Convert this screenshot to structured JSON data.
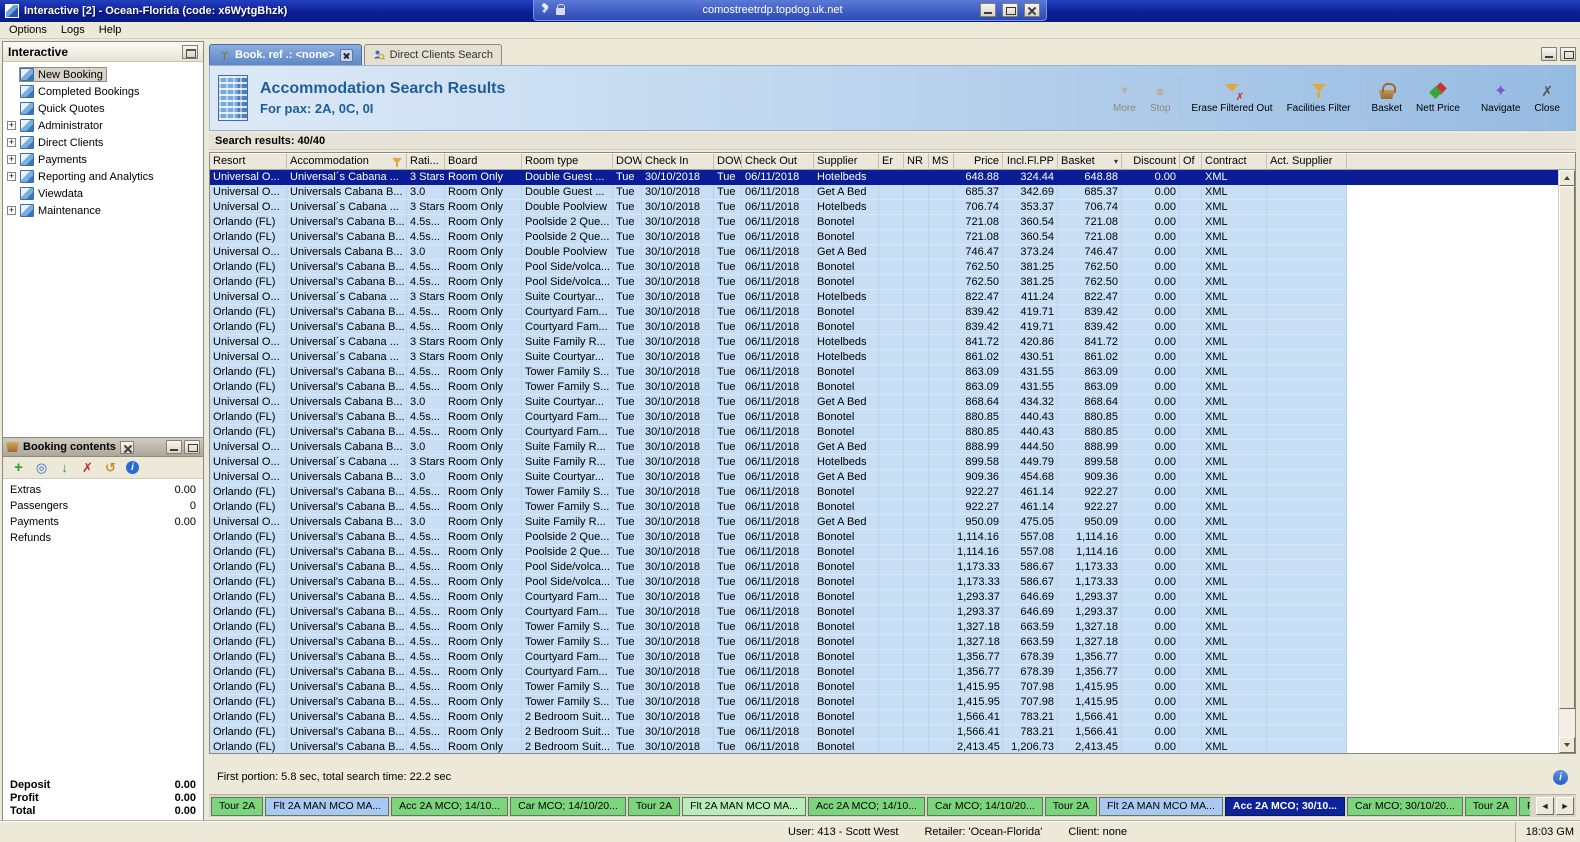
{
  "window": {
    "title": "Interactive [2] - Ocean-Florida (code: x6WytgBhzk)",
    "rdp_address": "comostreetrdp.topdog.uk.net"
  },
  "icons": {
    "singletons": [
      "app-icon",
      "pin-icon",
      "lock-icon",
      "palm-tree-icon",
      "client-search-icon",
      "hotel-building-icon",
      "filter-funnel-icon",
      "sort-icon",
      "info-icon"
    ]
  },
  "menu": {
    "items": [
      "Options",
      "Logs",
      "Help"
    ]
  },
  "sidebar": {
    "title": "Interactive",
    "items": [
      {
        "label": "New Booking",
        "icon": "new-booking-icon",
        "selected": true
      },
      {
        "label": "Completed Bookings",
        "icon": "completed-bookings-icon"
      },
      {
        "label": "Quick Quotes",
        "icon": "quick-quotes-icon"
      },
      {
        "label": "Administrator",
        "icon": "administrator-icon",
        "expandable": true
      },
      {
        "label": "Direct Clients",
        "icon": "direct-clients-icon",
        "expandable": true
      },
      {
        "label": "Payments",
        "icon": "payments-icon",
        "expandable": true
      },
      {
        "label": "Reporting and Analytics",
        "icon": "reporting-icon",
        "expandable": true
      },
      {
        "label": "Viewdata",
        "icon": "viewdata-icon"
      },
      {
        "label": "Maintenance",
        "icon": "maintenance-icon",
        "expandable": true
      }
    ]
  },
  "booking_contents": {
    "title": "Booking contents",
    "toolbar": [
      {
        "name": "add-icon",
        "glyph": "+"
      },
      {
        "name": "view-icon",
        "glyph": "◎"
      },
      {
        "name": "move-to-basket-icon",
        "glyph": "↓"
      },
      {
        "name": "delete-icon",
        "glyph": "✗"
      },
      {
        "name": "refresh-icon",
        "glyph": "↺"
      },
      {
        "name": "info-icon",
        "glyph": "i"
      }
    ],
    "rows": [
      {
        "label": "Extras",
        "value": "0.00"
      },
      {
        "label": "Passengers",
        "value": "0"
      },
      {
        "label": "Payments",
        "value": "0.00"
      },
      {
        "label": "Refunds",
        "value": ""
      }
    ],
    "totals": [
      {
        "label": "Deposit",
        "value": "0.00"
      },
      {
        "label": "Profit",
        "value": "0.00"
      },
      {
        "label": "Total",
        "value": "0.00"
      }
    ]
  },
  "tabs": [
    {
      "label": "Book. ref .: <none>",
      "icon": "palm-tree-icon",
      "active": true,
      "closable": true
    },
    {
      "label": "Direct Clients Search",
      "icon": "client-search-icon",
      "active": false
    }
  ],
  "header": {
    "icon": "hotel-building-icon",
    "title": "Accommodation Search Results",
    "subtitle": "For pax: 2A, 0C, 0I",
    "toolbar": [
      {
        "label": "More",
        "icon": "more-icon",
        "disabled": true
      },
      {
        "label": "Stop",
        "icon": "stop-icon",
        "disabled": true,
        "divider_after": true
      },
      {
        "label": "Erase Filtered Out",
        "icon": "erase-filter-icon"
      },
      {
        "label": "Facilities Filter",
        "icon": "facilities-filter-icon",
        "divider_after": true
      },
      {
        "label": "Basket",
        "icon": "basket-icon"
      },
      {
        "label": "Nett Price",
        "icon": "nett-price-icon",
        "divider_after": true
      },
      {
        "label": "Navigate",
        "icon": "navigate-icon"
      },
      {
        "label": "Close",
        "icon": "close-icon"
      }
    ]
  },
  "results": {
    "summary": "Search results: 40/40",
    "status": "First portion: 5.8 sec, total search time: 22.2 sec",
    "status_icon": "info-icon",
    "columns": [
      {
        "label": "Resort"
      },
      {
        "label": "Accommodation",
        "icon": "filter-funnel-icon"
      },
      {
        "label": "Rati..."
      },
      {
        "label": "Board"
      },
      {
        "label": "Room type"
      },
      {
        "label": "DOW"
      },
      {
        "label": "Check In"
      },
      {
        "label": "DOW"
      },
      {
        "label": "Check Out"
      },
      {
        "label": "Supplier"
      },
      {
        "label": "Er"
      },
      {
        "label": "NR"
      },
      {
        "label": "MS"
      },
      {
        "label": "Price"
      },
      {
        "label": "Incl.Fl.PP"
      },
      {
        "label": "Basket",
        "icon": "sort-icon"
      },
      {
        "label": "Discount"
      },
      {
        "label": "Of"
      },
      {
        "label": "Contract"
      },
      {
        "label": "Act. Supplier"
      }
    ],
    "row_constants": {
      "board": "Room Only",
      "dow_in": "Tue",
      "check_in": "30/10/2018",
      "dow_out": "Tue",
      "check_out": "06/11/2018",
      "discount": "0.00",
      "contract": "XML"
    },
    "rows": [
      {
        "resort": "Universal O...",
        "accommodation": "Universal´s Cabana ...",
        "rating": "3 Stars",
        "room_type": "Double Guest ...",
        "supplier": "Hotelbeds",
        "price": "648.88",
        "incl_fl_pp": "324.44",
        "basket": "648.88",
        "selected": true
      },
      {
        "resort": "Universal O...",
        "accommodation": "Universals Cabana B...",
        "rating": "3.0",
        "room_type": "Double Guest ...",
        "supplier": "Get A Bed",
        "price": "685.37",
        "incl_fl_pp": "342.69",
        "basket": "685.37"
      },
      {
        "resort": "Universal O...",
        "accommodation": "Universal´s Cabana ...",
        "rating": "3 Stars",
        "room_type": "Double Poolview",
        "supplier": "Hotelbeds",
        "price": "706.74",
        "incl_fl_pp": "353.37",
        "basket": "706.74"
      },
      {
        "resort": "Orlando (FL)",
        "accommodation": "Universal's Cabana B...",
        "rating": "4.5s...",
        "room_type": "Poolside 2 Que...",
        "supplier": "Bonotel",
        "price": "721.08",
        "incl_fl_pp": "360.54",
        "basket": "721.08"
      },
      {
        "resort": "Orlando (FL)",
        "accommodation": "Universal's Cabana B...",
        "rating": "4.5s...",
        "room_type": "Poolside 2 Que...",
        "supplier": "Bonotel",
        "price": "721.08",
        "incl_fl_pp": "360.54",
        "basket": "721.08"
      },
      {
        "resort": "Universal O...",
        "accommodation": "Universals Cabana B...",
        "rating": "3.0",
        "room_type": "Double Poolview",
        "supplier": "Get A Bed",
        "price": "746.47",
        "incl_fl_pp": "373.24",
        "basket": "746.47"
      },
      {
        "resort": "Orlando (FL)",
        "accommodation": "Universal's Cabana B...",
        "rating": "4.5s...",
        "room_type": "Pool Side/volca...",
        "supplier": "Bonotel",
        "price": "762.50",
        "incl_fl_pp": "381.25",
        "basket": "762.50"
      },
      {
        "resort": "Orlando (FL)",
        "accommodation": "Universal's Cabana B...",
        "rating": "4.5s...",
        "room_type": "Pool Side/volca...",
        "supplier": "Bonotel",
        "price": "762.50",
        "incl_fl_pp": "381.25",
        "basket": "762.50"
      },
      {
        "resort": "Universal O...",
        "accommodation": "Universal´s Cabana ...",
        "rating": "3 Stars",
        "room_type": "Suite Courtyar...",
        "supplier": "Hotelbeds",
        "price": "822.47",
        "incl_fl_pp": "411.24",
        "basket": "822.47"
      },
      {
        "resort": "Orlando (FL)",
        "accommodation": "Universal's Cabana B...",
        "rating": "4.5s...",
        "room_type": "Courtyard Fam...",
        "supplier": "Bonotel",
        "price": "839.42",
        "incl_fl_pp": "419.71",
        "basket": "839.42"
      },
      {
        "resort": "Orlando (FL)",
        "accommodation": "Universal's Cabana B...",
        "rating": "4.5s...",
        "room_type": "Courtyard Fam...",
        "supplier": "Bonotel",
        "price": "839.42",
        "incl_fl_pp": "419.71",
        "basket": "839.42"
      },
      {
        "resort": "Universal O...",
        "accommodation": "Universal´s Cabana ...",
        "rating": "3 Stars",
        "room_type": "Suite Family R...",
        "supplier": "Hotelbeds",
        "price": "841.72",
        "incl_fl_pp": "420.86",
        "basket": "841.72"
      },
      {
        "resort": "Universal O...",
        "accommodation": "Universal´s Cabana ...",
        "rating": "3 Stars",
        "room_type": "Suite Courtyar...",
        "supplier": "Hotelbeds",
        "price": "861.02",
        "incl_fl_pp": "430.51",
        "basket": "861.02"
      },
      {
        "resort": "Orlando (FL)",
        "accommodation": "Universal's Cabana B...",
        "rating": "4.5s...",
        "room_type": "Tower Family S...",
        "supplier": "Bonotel",
        "price": "863.09",
        "incl_fl_pp": "431.55",
        "basket": "863.09"
      },
      {
        "resort": "Orlando (FL)",
        "accommodation": "Universal's Cabana B...",
        "rating": "4.5s...",
        "room_type": "Tower Family S...",
        "supplier": "Bonotel",
        "price": "863.09",
        "incl_fl_pp": "431.55",
        "basket": "863.09"
      },
      {
        "resort": "Universal O...",
        "accommodation": "Universals Cabana B...",
        "rating": "3.0",
        "room_type": "Suite Courtyar...",
        "supplier": "Get A Bed",
        "price": "868.64",
        "incl_fl_pp": "434.32",
        "basket": "868.64"
      },
      {
        "resort": "Orlando (FL)",
        "accommodation": "Universal's Cabana B...",
        "rating": "4.5s...",
        "room_type": "Courtyard Fam...",
        "supplier": "Bonotel",
        "price": "880.85",
        "incl_fl_pp": "440.43",
        "basket": "880.85"
      },
      {
        "resort": "Orlando (FL)",
        "accommodation": "Universal's Cabana B...",
        "rating": "4.5s...",
        "room_type": "Courtyard Fam...",
        "supplier": "Bonotel",
        "price": "880.85",
        "incl_fl_pp": "440.43",
        "basket": "880.85"
      },
      {
        "resort": "Universal O...",
        "accommodation": "Universals Cabana B...",
        "rating": "3.0",
        "room_type": "Suite Family R...",
        "supplier": "Get A Bed",
        "price": "888.99",
        "incl_fl_pp": "444.50",
        "basket": "888.99"
      },
      {
        "resort": "Universal O...",
        "accommodation": "Universal´s Cabana ...",
        "rating": "3 Stars",
        "room_type": "Suite Family R...",
        "supplier": "Hotelbeds",
        "price": "899.58",
        "incl_fl_pp": "449.79",
        "basket": "899.58"
      },
      {
        "resort": "Universal O...",
        "accommodation": "Universals Cabana B...",
        "rating": "3.0",
        "room_type": "Suite Courtyar...",
        "supplier": "Get A Bed",
        "price": "909.36",
        "incl_fl_pp": "454.68",
        "basket": "909.36"
      },
      {
        "resort": "Orlando (FL)",
        "accommodation": "Universal's Cabana B...",
        "rating": "4.5s...",
        "room_type": "Tower Family S...",
        "supplier": "Bonotel",
        "price": "922.27",
        "incl_fl_pp": "461.14",
        "basket": "922.27"
      },
      {
        "resort": "Orlando (FL)",
        "accommodation": "Universal's Cabana B...",
        "rating": "4.5s...",
        "room_type": "Tower Family S...",
        "supplier": "Bonotel",
        "price": "922.27",
        "incl_fl_pp": "461.14",
        "basket": "922.27"
      },
      {
        "resort": "Universal O...",
        "accommodation": "Universals Cabana B...",
        "rating": "3.0",
        "room_type": "Suite Family R...",
        "supplier": "Get A Bed",
        "price": "950.09",
        "incl_fl_pp": "475.05",
        "basket": "950.09"
      },
      {
        "resort": "Orlando (FL)",
        "accommodation": "Universal's Cabana B...",
        "rating": "4.5s...",
        "room_type": "Poolside 2 Que...",
        "supplier": "Bonotel",
        "price": "1,114.16",
        "incl_fl_pp": "557.08",
        "basket": "1,114.16"
      },
      {
        "resort": "Orlando (FL)",
        "accommodation": "Universal's Cabana B...",
        "rating": "4.5s...",
        "room_type": "Poolside 2 Que...",
        "supplier": "Bonotel",
        "price": "1,114.16",
        "incl_fl_pp": "557.08",
        "basket": "1,114.16"
      },
      {
        "resort": "Orlando (FL)",
        "accommodation": "Universal's Cabana B...",
        "rating": "4.5s...",
        "room_type": "Pool Side/volca...",
        "supplier": "Bonotel",
        "price": "1,173.33",
        "incl_fl_pp": "586.67",
        "basket": "1,173.33"
      },
      {
        "resort": "Orlando (FL)",
        "accommodation": "Universal's Cabana B...",
        "rating": "4.5s...",
        "room_type": "Pool Side/volca...",
        "supplier": "Bonotel",
        "price": "1,173.33",
        "incl_fl_pp": "586.67",
        "basket": "1,173.33"
      },
      {
        "resort": "Orlando (FL)",
        "accommodation": "Universal's Cabana B...",
        "rating": "4.5s...",
        "room_type": "Courtyard Fam...",
        "supplier": "Bonotel",
        "price": "1,293.37",
        "incl_fl_pp": "646.69",
        "basket": "1,293.37"
      },
      {
        "resort": "Orlando (FL)",
        "accommodation": "Universal's Cabana B...",
        "rating": "4.5s...",
        "room_type": "Courtyard Fam...",
        "supplier": "Bonotel",
        "price": "1,293.37",
        "incl_fl_pp": "646.69",
        "basket": "1,293.37"
      },
      {
        "resort": "Orlando (FL)",
        "accommodation": "Universal's Cabana B...",
        "rating": "4.5s...",
        "room_type": "Tower Family S...",
        "supplier": "Bonotel",
        "price": "1,327.18",
        "incl_fl_pp": "663.59",
        "basket": "1,327.18"
      },
      {
        "resort": "Orlando (FL)",
        "accommodation": "Universal's Cabana B...",
        "rating": "4.5s...",
        "room_type": "Tower Family S...",
        "supplier": "Bonotel",
        "price": "1,327.18",
        "incl_fl_pp": "663.59",
        "basket": "1,327.18"
      },
      {
        "resort": "Orlando (FL)",
        "accommodation": "Universal's Cabana B...",
        "rating": "4.5s...",
        "room_type": "Courtyard Fam...",
        "supplier": "Bonotel",
        "price": "1,356.77",
        "incl_fl_pp": "678.39",
        "basket": "1,356.77"
      },
      {
        "resort": "Orlando (FL)",
        "accommodation": "Universal's Cabana B...",
        "rating": "4.5s...",
        "room_type": "Courtyard Fam...",
        "supplier": "Bonotel",
        "price": "1,356.77",
        "incl_fl_pp": "678.39",
        "basket": "1,356.77"
      },
      {
        "resort": "Orlando (FL)",
        "accommodation": "Universal's Cabana B...",
        "rating": "4.5s...",
        "room_type": "Tower Family S...",
        "supplier": "Bonotel",
        "price": "1,415.95",
        "incl_fl_pp": "707.98",
        "basket": "1,415.95"
      },
      {
        "resort": "Orlando (FL)",
        "accommodation": "Universal's Cabana B...",
        "rating": "4.5s...",
        "room_type": "Tower Family S...",
        "supplier": "Bonotel",
        "price": "1,415.95",
        "incl_fl_pp": "707.98",
        "basket": "1,415.95"
      },
      {
        "resort": "Orlando (FL)",
        "accommodation": "Universal's Cabana B...",
        "rating": "4.5s...",
        "room_type": "2 Bedroom Suit...",
        "supplier": "Bonotel",
        "price": "1,566.41",
        "incl_fl_pp": "783.21",
        "basket": "1,566.41"
      },
      {
        "resort": "Orlando (FL)",
        "accommodation": "Universal's Cabana B...",
        "rating": "4.5s...",
        "room_type": "2 Bedroom Suit...",
        "supplier": "Bonotel",
        "price": "1,566.41",
        "incl_fl_pp": "783.21",
        "basket": "1,566.41"
      },
      {
        "resort": "Orlando (FL)",
        "accommodation": "Universal's Cabana B...",
        "rating": "4.5s...",
        "room_type": "2 Bedroom Suit...",
        "supplier": "Bonotel",
        "price": "2,413.45",
        "incl_fl_pp": "1,206.73",
        "basket": "2,413.45"
      }
    ]
  },
  "bottom_tabs": [
    {
      "label": "Tour 2A",
      "color": "#7cd47c"
    },
    {
      "label": "Flt 2A MAN MCO MA...",
      "color": "#a9c9f2"
    },
    {
      "label": "Acc 2A MCO; 14/10...",
      "color": "#7cd47c"
    },
    {
      "label": "Car MCO; 14/10/20...",
      "color": "#7cd47c"
    },
    {
      "label": "Tour 2A",
      "color": "#7cd47c"
    },
    {
      "label": "Flt 2A MAN MCO MA...",
      "color": "#b9ecb9"
    },
    {
      "label": "Acc 2A MCO; 14/10...",
      "color": "#7cd47c"
    },
    {
      "label": "Car MCO; 14/10/20...",
      "color": "#7cd47c"
    },
    {
      "label": "Tour 2A",
      "color": "#7cd47c"
    },
    {
      "label": "Flt 2A MAN MCO MA...",
      "color": "#a9c9f2"
    },
    {
      "label": "Acc 2A MCO; 30/10...",
      "color": "#0c2399",
      "selected": true
    },
    {
      "label": "Car MCO; 30/10/20...",
      "color": "#7cd47c"
    },
    {
      "label": "Tour 2A",
      "color": "#7cd47c"
    },
    {
      "label": "Financial Summary",
      "color": "#7cd47c"
    }
  ],
  "status_bar": {
    "user": "User: 413 - Scott West",
    "retailer": "Retailer: 'Ocean-Florida'",
    "client": "Client: none",
    "time": "18:03 GM"
  }
}
